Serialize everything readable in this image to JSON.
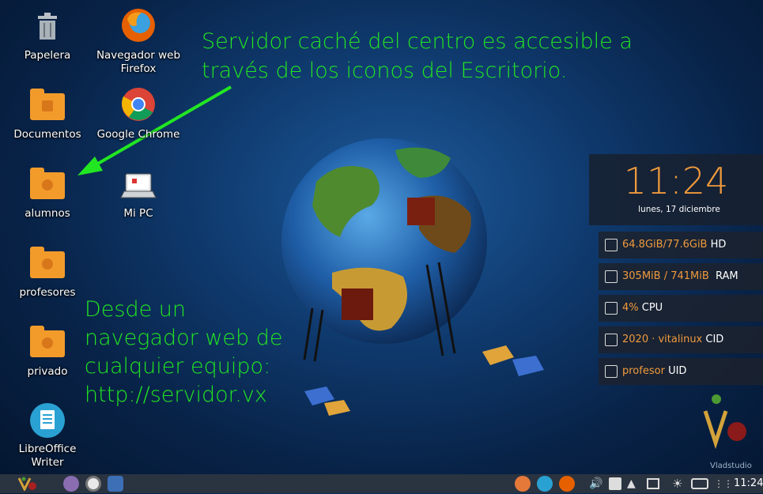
{
  "desktop_icons": {
    "papelera": "Papelera",
    "firefox": "Navegador web Firefox",
    "documentos": "Documentos",
    "chrome": "Google Chrome",
    "alumnos": "alumnos",
    "mipc": "Mi PC",
    "profesores": "profesores",
    "privado": "privado",
    "writer": "LibreOffice Writer"
  },
  "annotations": {
    "top_line1": "Servidor caché del centro es accesible a",
    "top_line2": "través de los iconos del Escritorio.",
    "left_line1": "Desde un",
    "left_line2": "navegador web de",
    "left_line3": "cualquier equipo:",
    "left_line4": "http://servidor.vx"
  },
  "conky": {
    "time": "11:24",
    "date": "lunes, 17 diciembre",
    "rows": [
      {
        "value": "64.8GiB/77.6GiB",
        "label": "HD",
        "icon": "harddisk-icon"
      },
      {
        "value": "305MiB / 741MiB",
        "label": "RAM",
        "icon": "memory-icon"
      },
      {
        "value": "4%",
        "label": "CPU",
        "icon": "cpu-icon"
      },
      {
        "value": "2020 · vitalinux",
        "label": "CID",
        "icon": "id-icon"
      },
      {
        "value": "profesor",
        "label": "UID",
        "icon": "user-icon"
      }
    ]
  },
  "watermark": "Vladstudio",
  "taskbar": {
    "clock": "11:24"
  },
  "colors": {
    "annotation": "#22e622",
    "accent_orange": "#f09a3c",
    "folder": "#f29b2b",
    "taskbar": "#2a3340"
  }
}
